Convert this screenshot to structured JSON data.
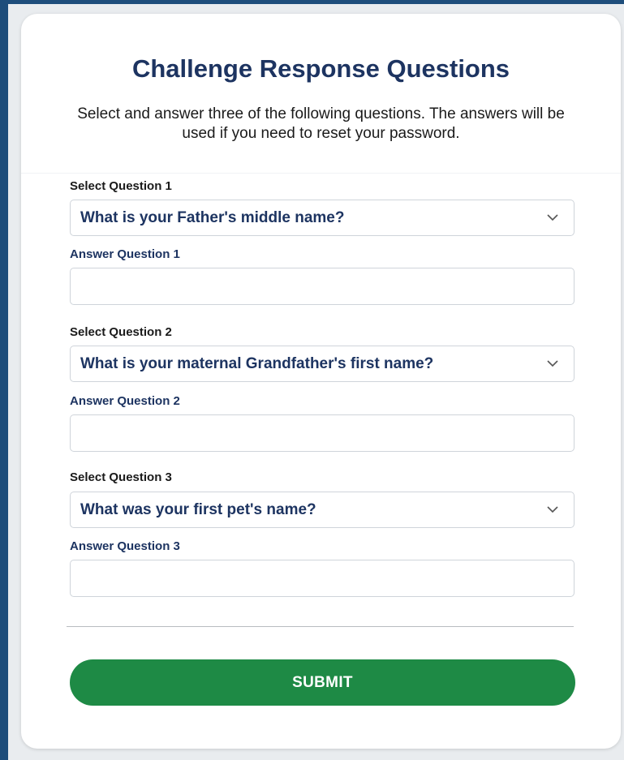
{
  "form": {
    "title": "Challenge Response Questions",
    "intro": "Select and answer three of the following questions. The answers will be used if you need to reset your password.",
    "questions": [
      {
        "select_label": "Select Question 1",
        "selected": "What is your Father's middle name?",
        "answer_label": "Answer Question 1",
        "answer_value": ""
      },
      {
        "select_label": "Select Question 2",
        "selected": "What is your maternal Grandfather's first name?",
        "answer_label": "Answer Question 2",
        "answer_value": ""
      },
      {
        "select_label": "Select Question 3",
        "selected": "What was your first pet's name?",
        "answer_label": "Answer Question 3",
        "answer_value": ""
      }
    ],
    "submit_label": "SUBMIT"
  },
  "icons": {
    "dropdown": "chevron-down-icon"
  },
  "colors": {
    "frame_border": "#1e4d7b",
    "title": "#1d3461",
    "submit": "#1e8a45"
  }
}
